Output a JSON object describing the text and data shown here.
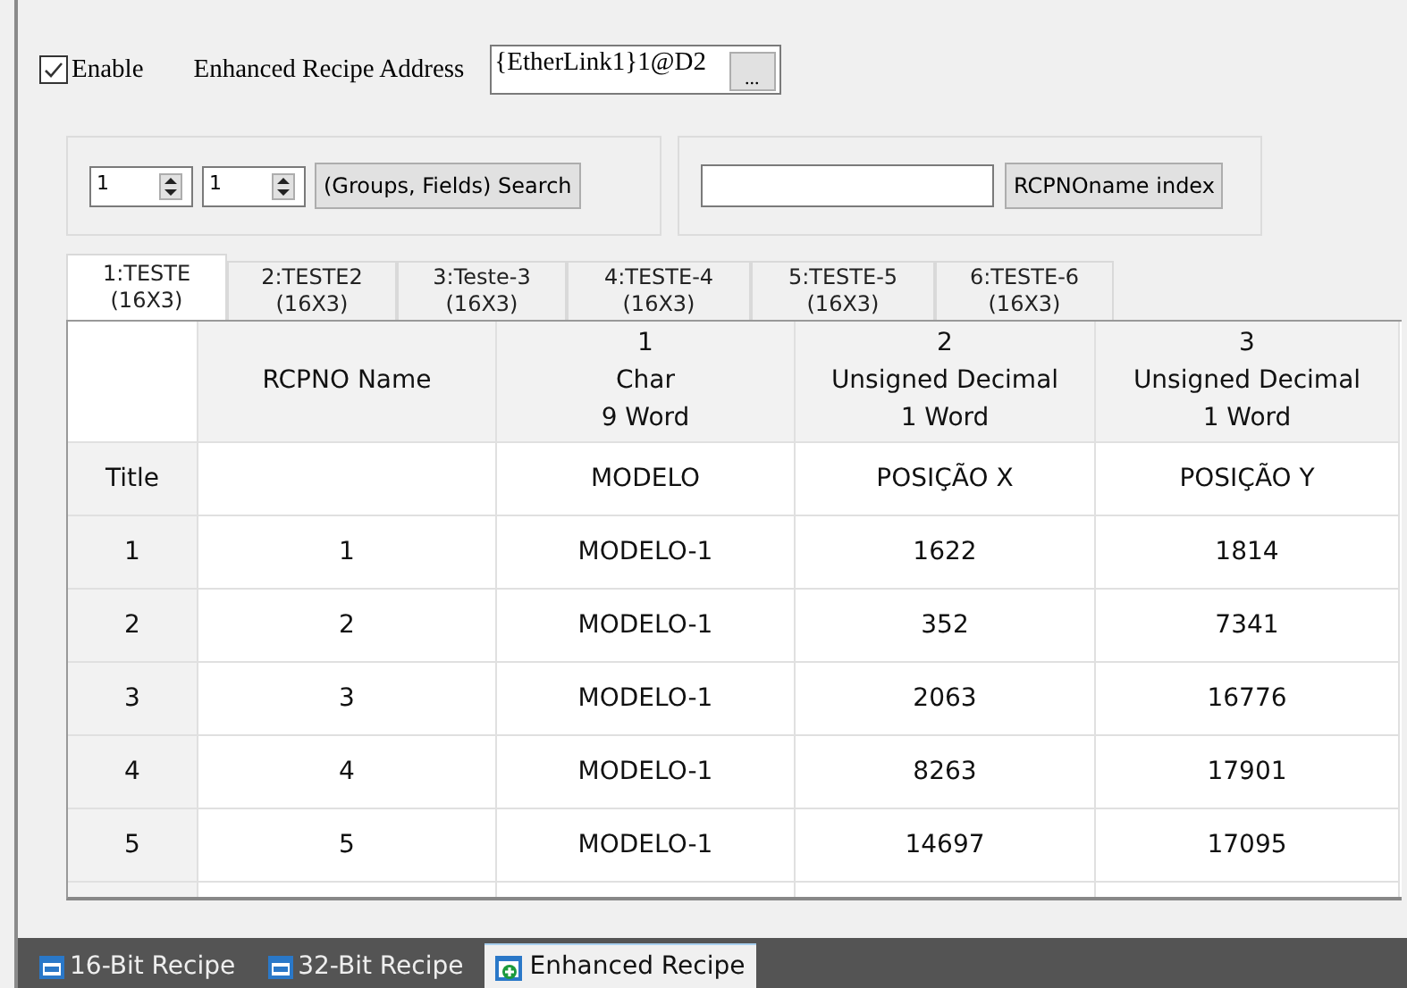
{
  "enable": {
    "label": "Enable",
    "checked": true
  },
  "address": {
    "label": "Enhanced Recipe Address",
    "value": "{EtherLink1}1@D2",
    "browse": "..."
  },
  "search": {
    "group": "1",
    "field": "1",
    "button": "(Groups, Fields) Search"
  },
  "name_search": {
    "button": "RCPNOname index"
  },
  "tabs": [
    {
      "label": "1:TESTE",
      "size": "(16X3)",
      "selected": true
    },
    {
      "label": "2:TESTE2",
      "size": "(16X3)",
      "selected": false
    },
    {
      "label": "3:Teste-3",
      "size": "(16X3)",
      "selected": false
    },
    {
      "label": "4:TESTE-4",
      "size": "(16X3)",
      "selected": false
    },
    {
      "label": "5:TESTE-5",
      "size": "(16X3)",
      "selected": false
    },
    {
      "label": "6:TESTE-6",
      "size": "(16X3)",
      "selected": false
    }
  ],
  "table": {
    "columns": [
      {
        "lines": [
          "RCPNO Name"
        ]
      },
      {
        "lines": [
          "1",
          "Char",
          "9 Word"
        ]
      },
      {
        "lines": [
          "2",
          "Unsigned Decimal",
          "1 Word"
        ]
      },
      {
        "lines": [
          "3",
          "Unsigned Decimal",
          "1 Word"
        ]
      }
    ],
    "rows": [
      {
        "header": "Title",
        "cells": [
          "",
          "MODELO",
          "POSIÇÃO X",
          "POSIÇÃO Y"
        ]
      },
      {
        "header": "1",
        "cells": [
          "1",
          "MODELO-1",
          "1622",
          "1814"
        ]
      },
      {
        "header": "2",
        "cells": [
          "2",
          "MODELO-1",
          "352",
          "7341"
        ]
      },
      {
        "header": "3",
        "cells": [
          "3",
          "MODELO-1",
          "2063",
          "16776"
        ]
      },
      {
        "header": "4",
        "cells": [
          "4",
          "MODELO-1",
          "8263",
          "17901"
        ]
      },
      {
        "header": "5",
        "cells": [
          "5",
          "MODELO-1",
          "14697",
          "17095"
        ]
      }
    ]
  },
  "bottom_tabs": [
    {
      "label": "16-Bit Recipe",
      "kind": "bit16",
      "selected": false
    },
    {
      "label": "32-Bit Recipe",
      "kind": "bit32",
      "selected": false
    },
    {
      "label": "Enhanced Recipe",
      "kind": "enhanced",
      "selected": true
    }
  ]
}
